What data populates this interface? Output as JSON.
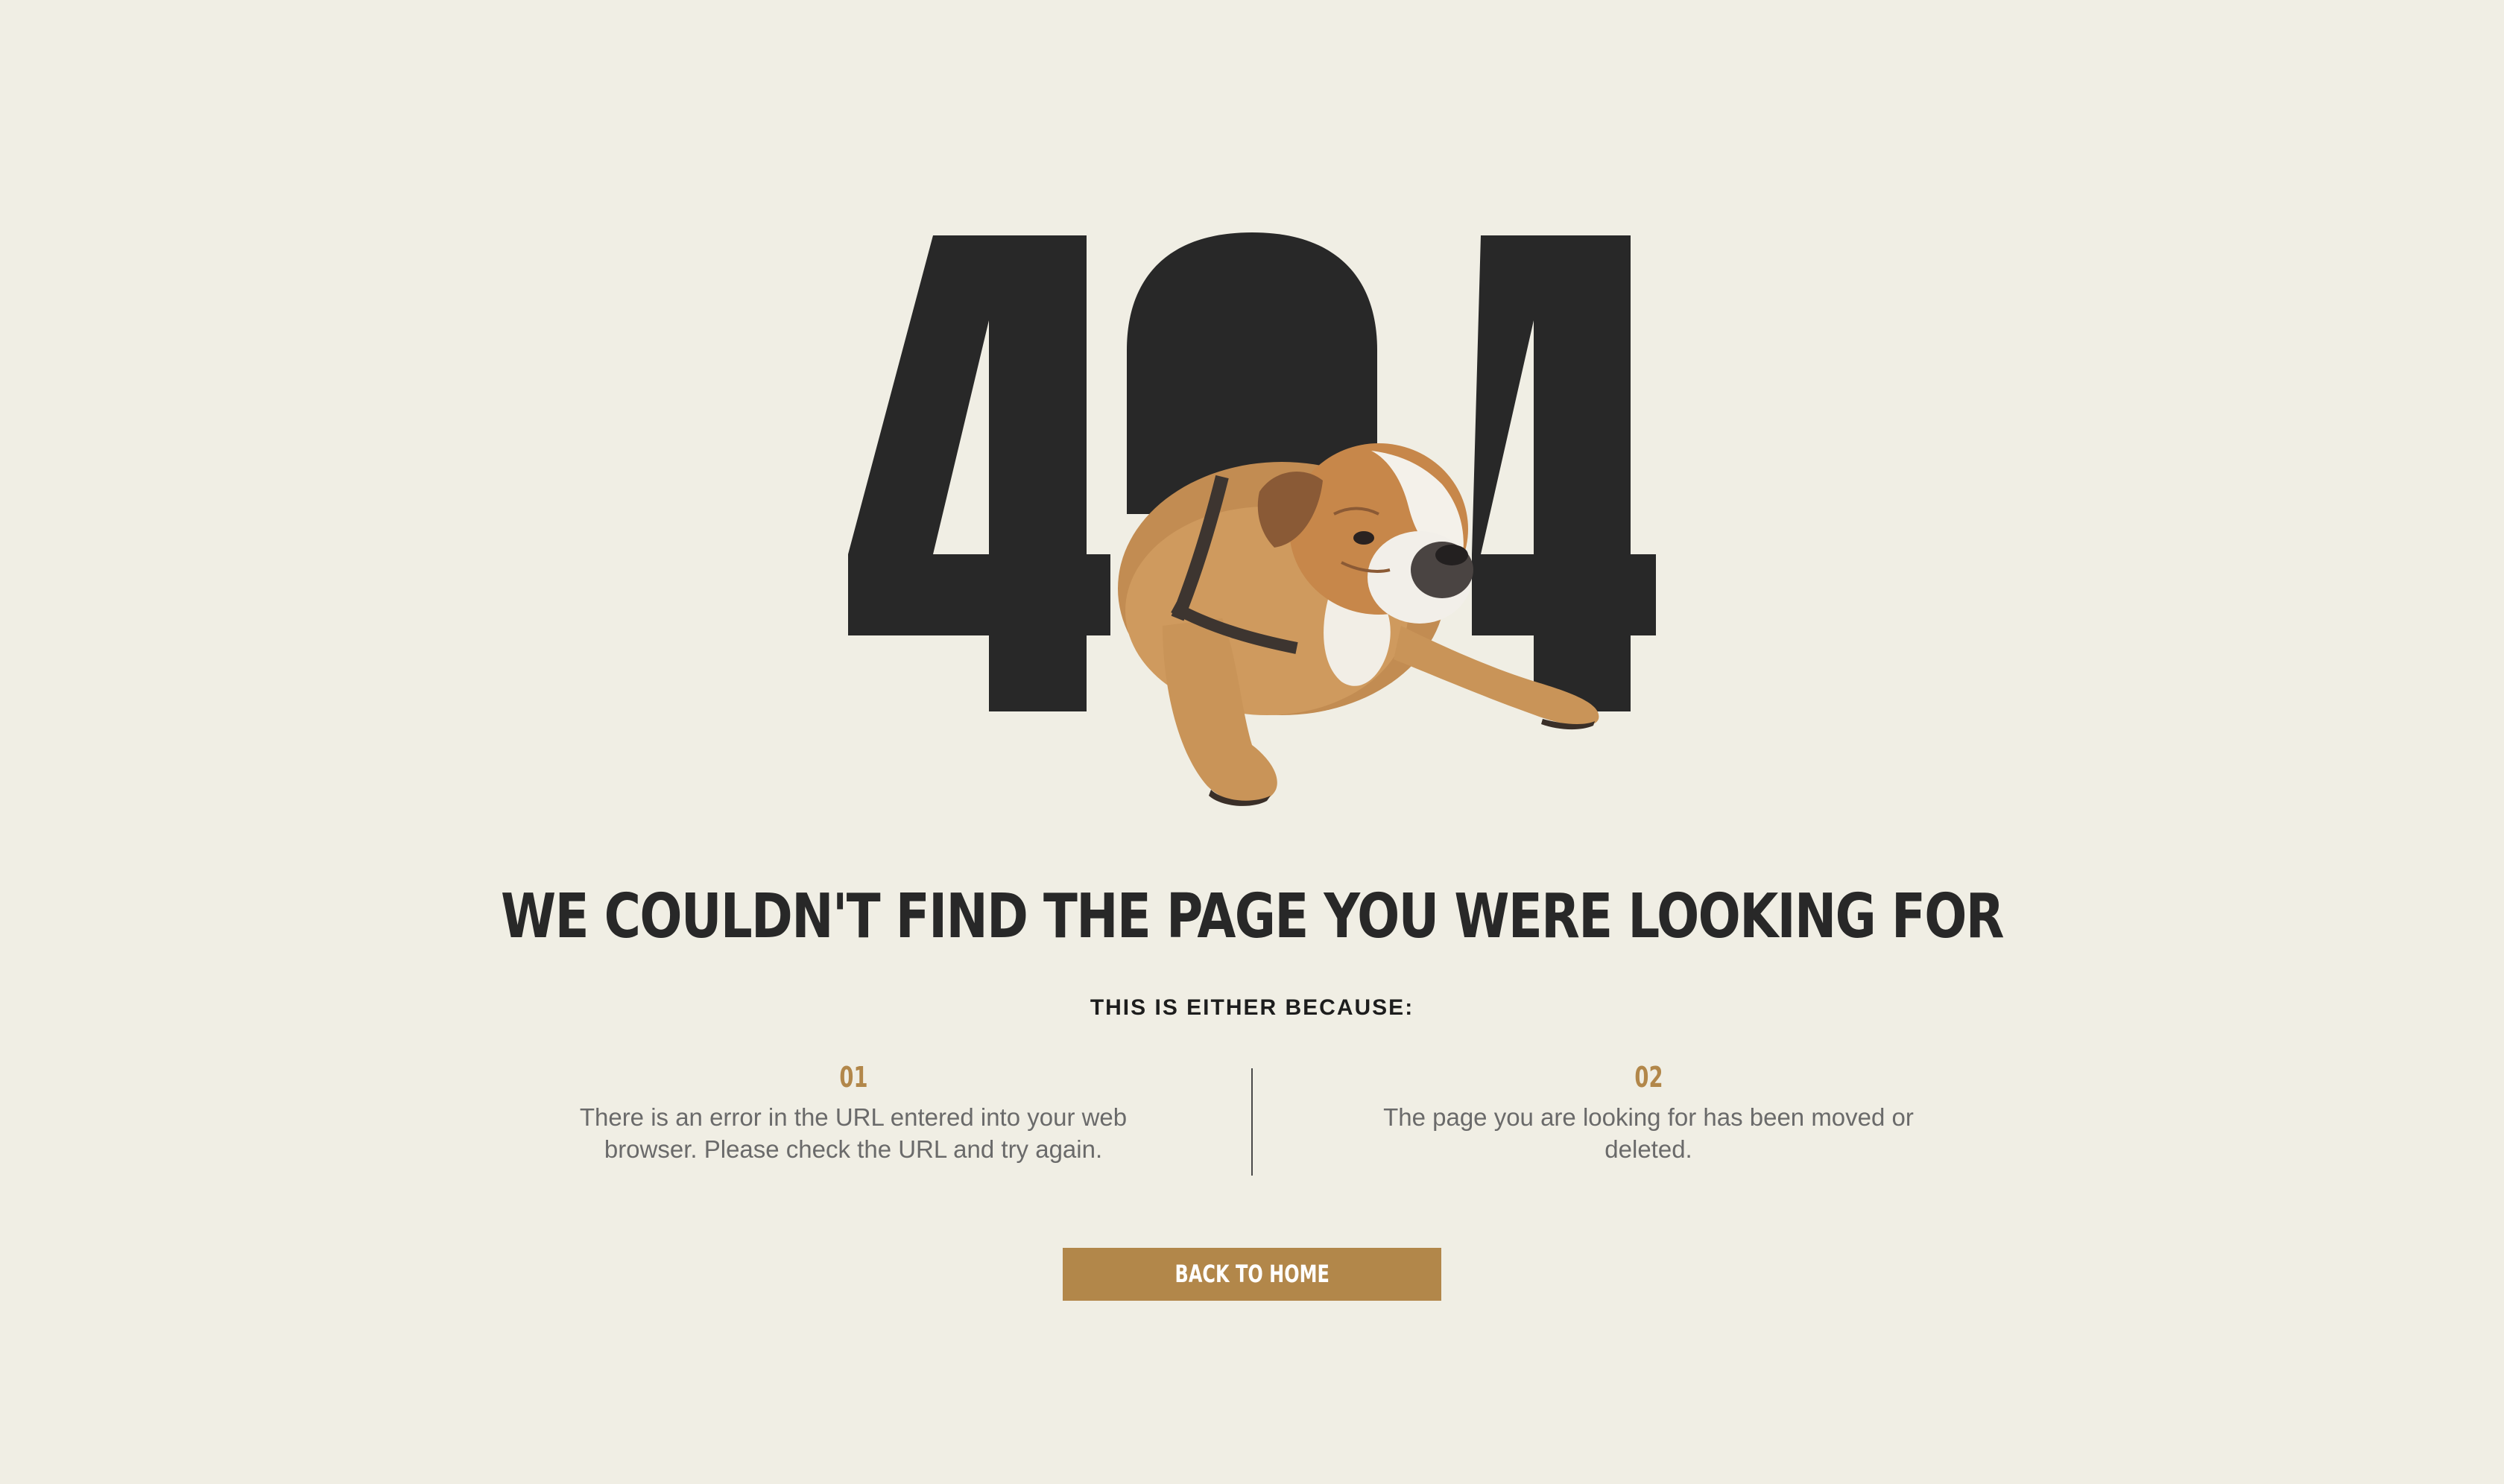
{
  "hero": {
    "code_first": "4",
    "code_last": "4"
  },
  "heading": "WE COULDN'T FIND THE PAGE YOU WERE LOOKING FOR",
  "subheading": "THIS IS EITHER BECAUSE:",
  "reasons": [
    {
      "number": "01",
      "text": "There is an error in the URL entered into your web browser. Please check the URL and try again."
    },
    {
      "number": "02",
      "text": "The page you are looking for has been moved or deleted."
    }
  ],
  "button": {
    "label": "BACK TO HOME"
  },
  "colors": {
    "background": "#f0eee4",
    "dark": "#282828",
    "accent": "#b2874a",
    "body_text": "#6a6a6a"
  },
  "icons": {
    "hero_image": "bulldog-illustration"
  }
}
